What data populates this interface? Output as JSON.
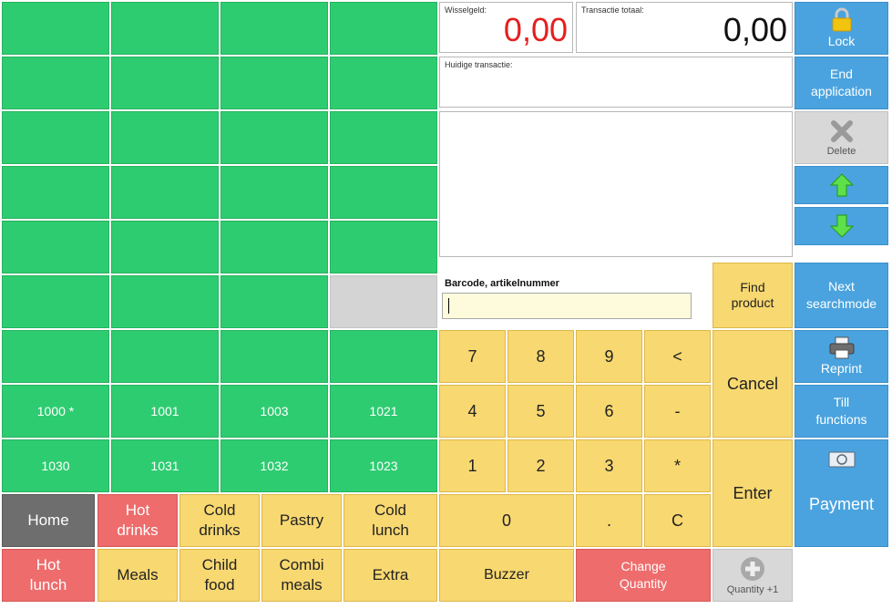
{
  "product_grid": {
    "codes_row1": [
      "1000 *",
      "1001",
      "1003",
      "1021"
    ],
    "codes_row2": [
      "1030",
      "1031",
      "1032",
      "1023"
    ]
  },
  "categories": {
    "home": "Home",
    "hot_drinks": "Hot\ndrinks",
    "cold_drinks": "Cold\ndrinks",
    "pastry": "Pastry",
    "cold_lunch": "Cold\nlunch",
    "hot_lunch": "Hot\nlunch",
    "meals": "Meals",
    "child_food": "Child\nfood",
    "combi_meals": "Combi\nmeals",
    "extra": "Extra"
  },
  "display": {
    "change_label": "Wisselgeld:",
    "change_value": "0,00",
    "total_label": "Transactie totaal:",
    "total_value": "0,00",
    "current_label": "Huidige transactie:"
  },
  "barcode": {
    "label": "Barcode, artikelnummer",
    "value": ""
  },
  "keypad": {
    "k7": "7",
    "k8": "8",
    "k9": "9",
    "back": "<",
    "k4": "4",
    "k5": "5",
    "k6": "6",
    "minus": "-",
    "k1": "1",
    "k2": "2",
    "k3": "3",
    "star": "*",
    "k0": "0",
    "dot": ".",
    "clear": "C",
    "buzzer": "Buzzer",
    "change_qty": "Change\nQuantity",
    "qty_plus": "Quantity +1"
  },
  "actions": {
    "find_product": "Find\nproduct",
    "cancel": "Cancel",
    "enter": "Enter"
  },
  "sidebar": {
    "lock": "Lock",
    "end_app": "End\napplication",
    "delete": "Delete",
    "next_search": "Next\nsearchmode",
    "reprint": "Reprint",
    "till": "Till\nfunctions",
    "payment": "Payment"
  },
  "colors": {
    "product_green": "#2ecc71",
    "key_yellow": "#f8d870",
    "red": "#ee6c6c",
    "blue": "#4aa3df",
    "change_value_red": "#e41f1f"
  }
}
